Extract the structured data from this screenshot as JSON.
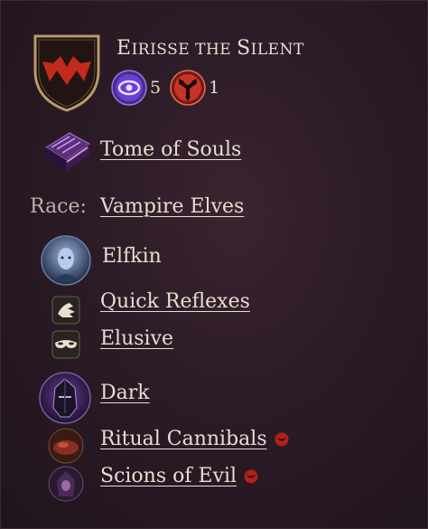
{
  "hero": {
    "name_first": "E",
    "name_rest": "irisse the ",
    "name_last_first": "S",
    "name_last_rest": "ilent"
  },
  "stats": [
    {
      "icon": "purple-eye-icon",
      "value": "5",
      "color": "#7b4ad6"
    },
    {
      "icon": "red-triangle-icon",
      "value": "1",
      "color": "#c4342a"
    }
  ],
  "book": {
    "icon": "tome-icon",
    "label": "Tome of Souls"
  },
  "race": {
    "label": "Race:",
    "value": "Vampire Elves"
  },
  "traits": [
    {
      "icon": "elf-portrait-icon",
      "label": "Elfkin",
      "link": false
    },
    {
      "icon": "reflex-icon",
      "label": "Quick Reflexes",
      "link": true
    },
    {
      "icon": "mask-icon",
      "label": "Elusive",
      "link": true
    },
    {
      "icon": "dark-helm-icon",
      "label": "Dark",
      "link": true
    },
    {
      "icon": "cannibal-icon",
      "label": "Ritual Cannibals",
      "link": true,
      "badge": "evil-badge-icon"
    },
    {
      "icon": "scion-icon",
      "label": "Scions of Evil",
      "link": true,
      "badge": "evil-badge-icon"
    }
  ],
  "colors": {
    "text": "#e7ddd2",
    "accent_red": "#b3201a",
    "purple": "#7b4ad6"
  }
}
